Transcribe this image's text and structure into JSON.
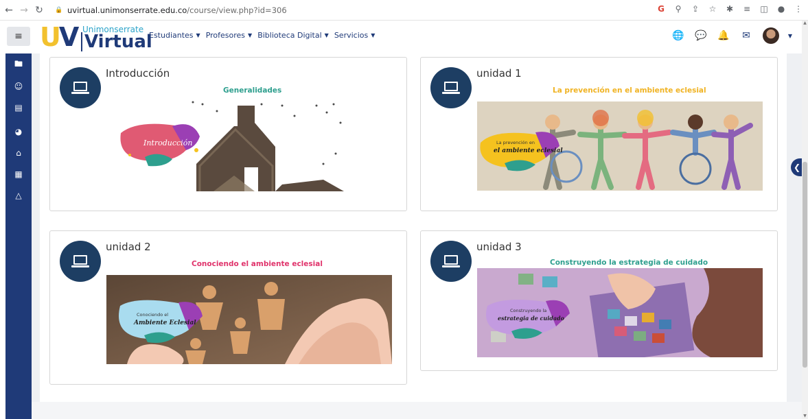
{
  "browser": {
    "url_host": "uvirtual.unimonserrate.edu.co",
    "url_path": "/course/view.php?id=306"
  },
  "logo": {
    "mark_u": "U",
    "mark_v": "V",
    "subtitle": "Unimonserrate",
    "title": "Virtual"
  },
  "menu": [
    {
      "label": "Estudiantes"
    },
    {
      "label": "Profesores"
    },
    {
      "label": "Biblioteca Digital"
    },
    {
      "label": "Servicios"
    }
  ],
  "sections": [
    {
      "title": "Introducción",
      "subtitle": "Generalidades",
      "subtitle_color": "#2e9f8e",
      "banner_text": "Introducción",
      "banner_color": "#e05a73"
    },
    {
      "title": "unidad 1",
      "subtitle": "La prevención en el ambiente eclesial",
      "subtitle_color": "#f0b323",
      "banner_text_top": "La prevención en",
      "banner_text_bottom": "el ambiente eclesial",
      "banner_color": "#f5c21f"
    },
    {
      "title": "unidad 2",
      "subtitle": "Conociendo el ambiente eclesial",
      "subtitle_color": "#e0336b",
      "banner_text_top": "Conociendo el",
      "banner_text_bottom": "Ambiente Eclesial",
      "banner_color": "#a9dcef"
    },
    {
      "title": "unidad 3",
      "subtitle": "Construyendo la estrategia de cuidado",
      "subtitle_color": "#2e9f8e",
      "banner_text_top": "Construyendo la",
      "banner_text_bottom": "estrategia de cuidado",
      "banner_color": "#c39be0"
    }
  ],
  "colors": {
    "brand_navy": "#1f3a78",
    "brand_yellow": "#f2c12e",
    "icon_circle": "#1d3e63"
  }
}
